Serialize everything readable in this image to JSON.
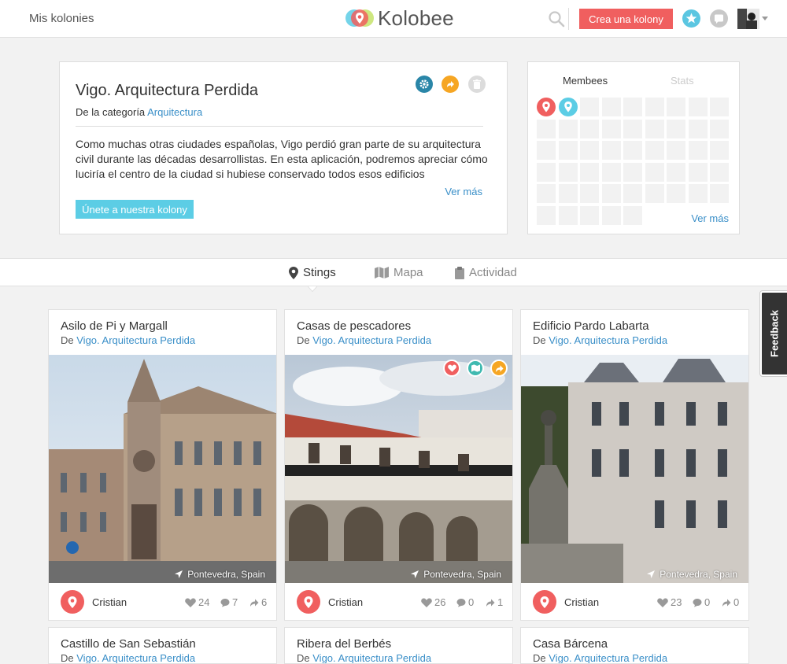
{
  "header": {
    "left_link": "Mis kolonies",
    "brand": "Kolobee",
    "create_button": "Crea una kolony"
  },
  "kolony": {
    "title": "Vigo. Arquitectura Perdida",
    "category_prefix": "De la categoría",
    "category": "Arquitectura",
    "description": "Como muchas otras ciudades españolas, Vigo perdió gran parte de su arquitectura civil durante las décadas desarrollistas. En esta aplicación, podremos apreciar cómo luciría el centro de la ciudad si hubiese conservado todos esos edificios",
    "see_more": "Ver más",
    "join_button": "Únete a nuestra kolony"
  },
  "members": {
    "tab_members": "Membees",
    "tab_stats": "Stats",
    "see_more": "Ver más"
  },
  "tabs": [
    {
      "label": "Stings",
      "icon": "map-pin-icon"
    },
    {
      "label": "Mapa",
      "icon": "map-icon"
    },
    {
      "label": "Actividad",
      "icon": "clipboard-icon"
    }
  ],
  "feedback": "Feedback",
  "cards": [
    {
      "title": "Asilo de Pi y Margall",
      "from_prefix": "De",
      "from": "Vigo. Arquitectura Perdida",
      "location": "Pontevedra, Spain",
      "user": "Cristian",
      "likes": "24",
      "comments": "7",
      "shares": "6"
    },
    {
      "title": "Casas de pescadores",
      "from_prefix": "De",
      "from": "Vigo. Arquitectura Perdida",
      "location": "Pontevedra, Spain",
      "user": "Cristian",
      "likes": "26",
      "comments": "0",
      "shares": "1"
    },
    {
      "title": "Edificio Pardo Labarta",
      "from_prefix": "De",
      "from": "Vigo. Arquitectura Perdida",
      "location": "Pontevedra, Spain",
      "user": "Cristian",
      "likes": "23",
      "comments": "0",
      "shares": "0"
    },
    {
      "title": "Castillo de San Sebastián",
      "from_prefix": "De",
      "from": "Vigo. Arquitectura Perdida"
    },
    {
      "title": "Ribera del Berbés",
      "from_prefix": "De",
      "from": "Vigo. Arquitectura Perdida"
    },
    {
      "title": "Casa Bárcena",
      "from_prefix": "De",
      "from": "Vigo. Arquitectura Perdida"
    }
  ],
  "colors": {
    "accent_red": "#f05f5f",
    "accent_cyan": "#5ccde5",
    "link_blue": "#3a8fc8",
    "orange": "#f6a623",
    "teal": "#3fb9b0"
  }
}
